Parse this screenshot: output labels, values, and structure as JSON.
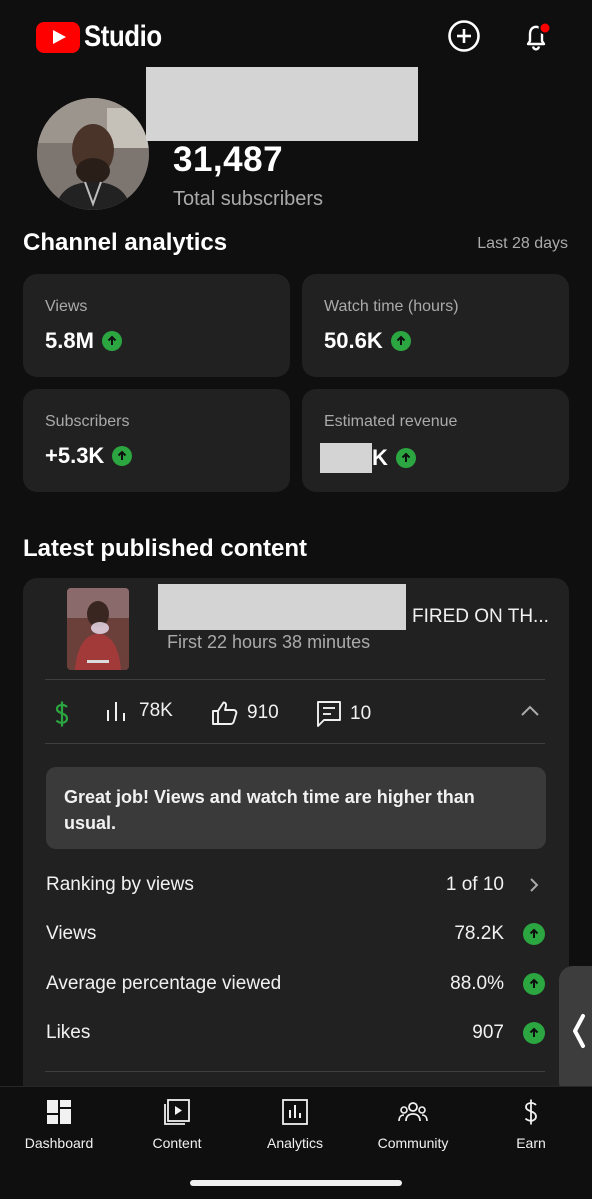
{
  "app": {
    "logo_text": "Studio",
    "colors": {
      "brand": "#ff0000",
      "up_badge": "#2ba640",
      "card_bg": "#212121",
      "notif_dot": "#ff0000"
    }
  },
  "header": {
    "create_icon": "plus-circle-icon",
    "notifications_icon": "bell-icon"
  },
  "channel": {
    "subscriber_count": "31,487",
    "subscriber_label": "Total subscribers"
  },
  "analytics": {
    "title": "Channel analytics",
    "period": "Last 28 days",
    "cards": [
      {
        "label": "Views",
        "value": "5.8M",
        "trend": "up"
      },
      {
        "label": "Watch time (hours)",
        "value": "50.6K",
        "trend": "up"
      },
      {
        "label": "Subscribers",
        "value": "+5.3K",
        "trend": "up"
      },
      {
        "label": "Estimated revenue",
        "value": "K",
        "trend": "up"
      }
    ]
  },
  "latest": {
    "title": "Latest published content",
    "video": {
      "title_suffix": "FIRED ON TH...",
      "time": "First 22 hours 38 minutes",
      "views": "78K",
      "likes": "910",
      "comments": "10"
    },
    "banner": "Great job! Views and watch time are higher than usual.",
    "rows": [
      {
        "label": "Ranking by views",
        "value": "1 of 10",
        "icon": "chevron-right-icon"
      },
      {
        "label": "Views",
        "value": "78.2K",
        "icon": "up-arrow-icon"
      },
      {
        "label": "Average percentage viewed",
        "value": "88.0%",
        "icon": "up-arrow-icon"
      },
      {
        "label": "Likes",
        "value": "907",
        "icon": "up-arrow-icon"
      }
    ]
  },
  "nav": {
    "items": [
      {
        "label": "Dashboard",
        "icon": "dashboard-icon"
      },
      {
        "label": "Content",
        "icon": "content-icon"
      },
      {
        "label": "Analytics",
        "icon": "analytics-icon"
      },
      {
        "label": "Community",
        "icon": "community-icon"
      },
      {
        "label": "Earn",
        "icon": "dollar-icon"
      }
    ]
  }
}
